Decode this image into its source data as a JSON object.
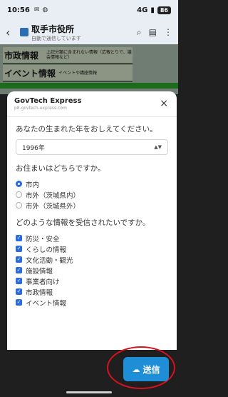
{
  "status": {
    "time": "10:56",
    "network": "4G",
    "battery": "86"
  },
  "appbar": {
    "title": "取手市役所",
    "subtitle": "自動で通信しています"
  },
  "background": {
    "rows": [
      {
        "big": "市政情報",
        "small": "上記分類に含まれない情報（広報とりで、議会情報など）"
      },
      {
        "big": "イベント情報",
        "small": "イベントや講座情報"
      }
    ]
  },
  "sheet": {
    "title": "GovTech Express",
    "url": "p8.govtech-express.com",
    "close": "×"
  },
  "form": {
    "q1": "あなたの生まれた年をおしえてください。",
    "year_value": "1996年",
    "q2": "お住まいはどちらですか。",
    "residence": [
      {
        "label": "市内",
        "selected": true
      },
      {
        "label": "市外（茨城県内）",
        "selected": false
      },
      {
        "label": "市外（茨城県外）",
        "selected": false
      }
    ],
    "q3": "どのような情報を受信されたいですか。",
    "categories": [
      {
        "label": "防災・安全",
        "checked": true
      },
      {
        "label": "くらしの情報",
        "checked": true
      },
      {
        "label": "文化活動・観光",
        "checked": true
      },
      {
        "label": "施設情報",
        "checked": true
      },
      {
        "label": "事業者向け",
        "checked": true
      },
      {
        "label": "市政情報",
        "checked": true
      },
      {
        "label": "イベント情報",
        "checked": true
      }
    ]
  },
  "send_label": "送信",
  "colors": {
    "accent": "#2a6cd9",
    "send": "#1e8fd6",
    "highlight_ring": "#d8121c"
  }
}
